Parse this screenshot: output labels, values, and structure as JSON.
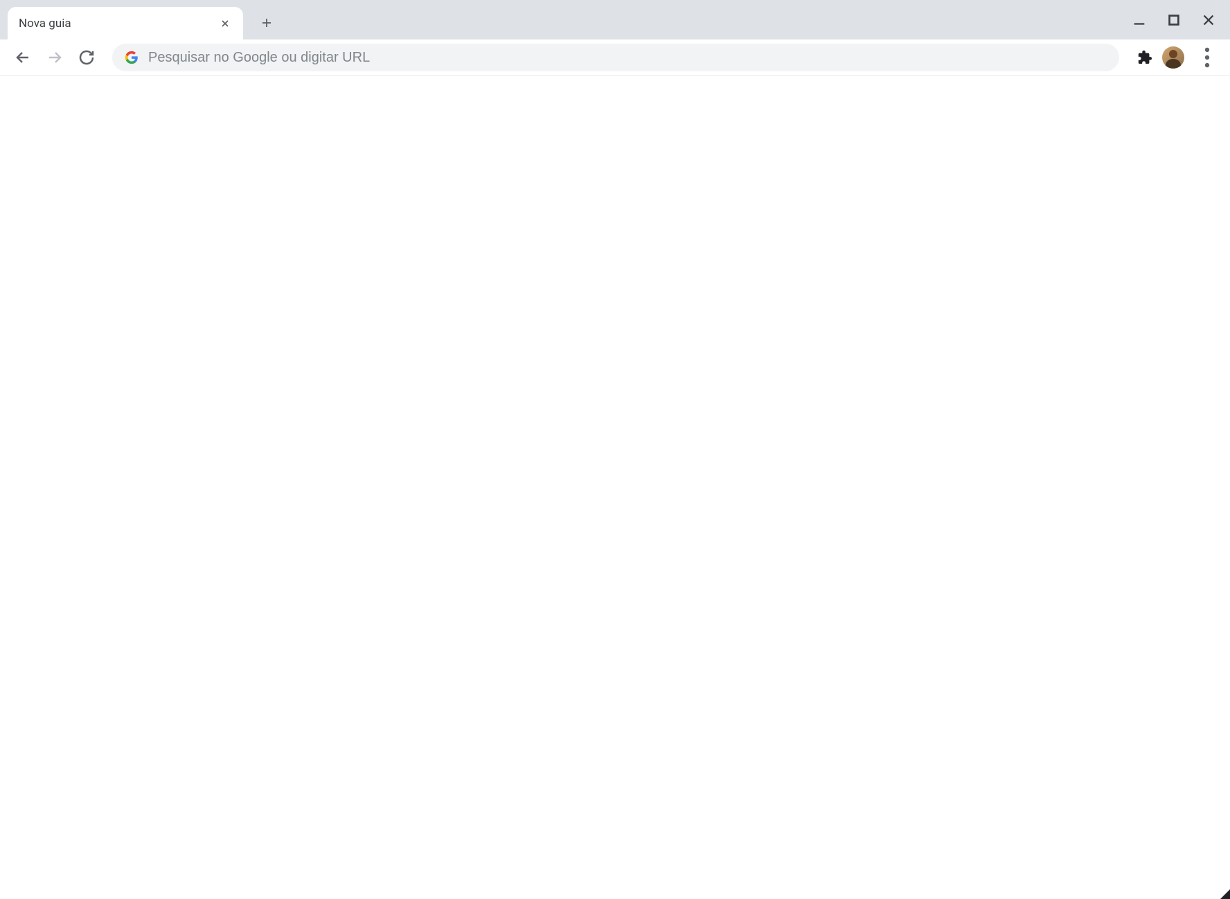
{
  "tab": {
    "title": "Nova guia"
  },
  "addressBar": {
    "placeholder": "Pesquisar no Google ou digitar URL",
    "value": ""
  }
}
